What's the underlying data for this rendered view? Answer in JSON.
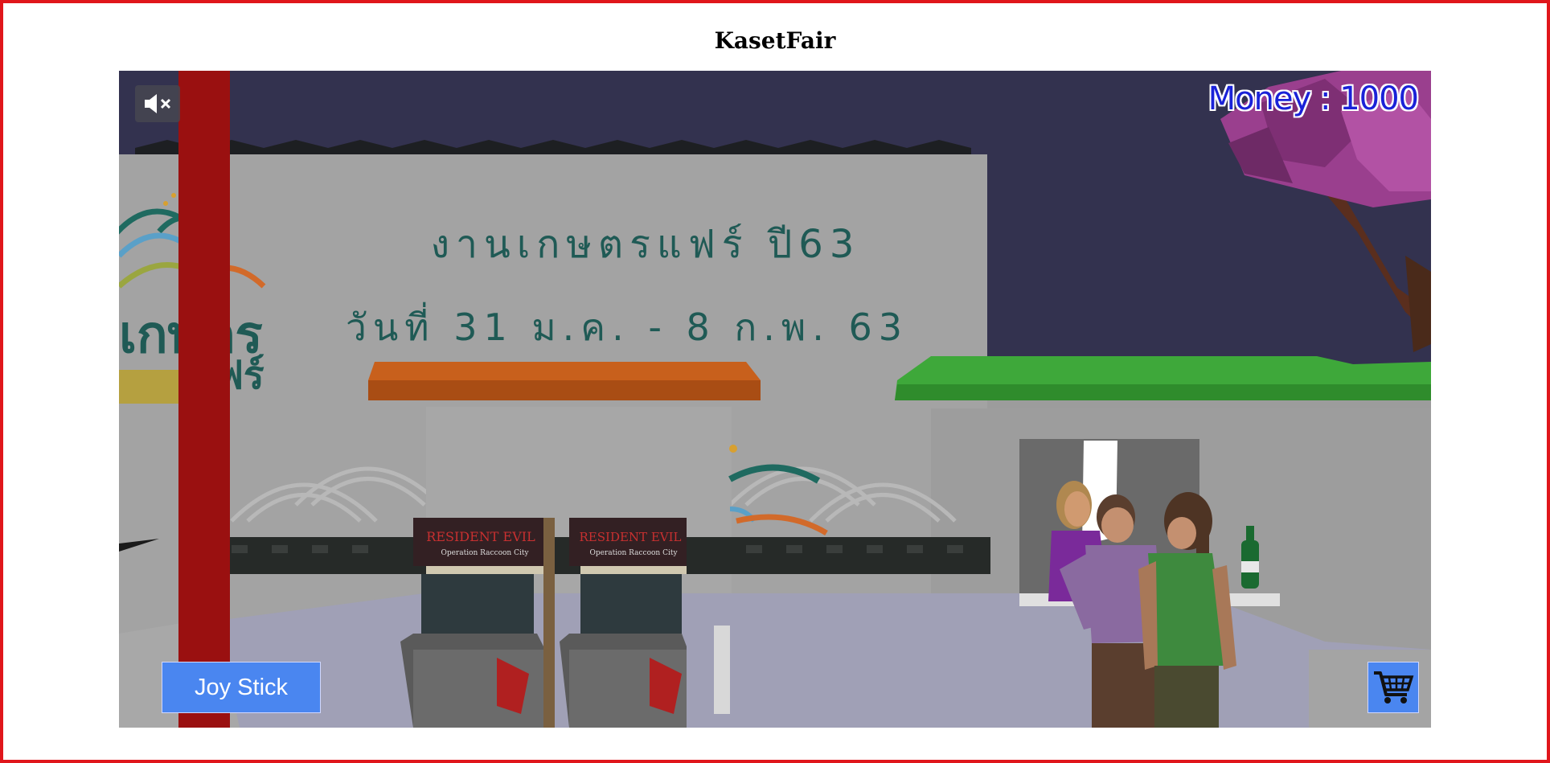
{
  "page": {
    "title": "KasetFair"
  },
  "hud": {
    "money_label": "Money",
    "money_separator": " : ",
    "money_value": "1000",
    "joystick_label": "Joy Stick"
  },
  "icons": {
    "mute": "speaker-muted-icon",
    "cart": "shopping-cart-icon"
  },
  "scene": {
    "banner_line1": "งานเกษตรแฟร์ ปี63",
    "banner_line2": "วันที่ 31 ม.ค. - 8 ก.พ. 63",
    "logo_text_top": "เกษตร",
    "logo_text_bottom": "แฟร์",
    "arcade_brand": "RESIDENT EVIL",
    "arcade_subtitle": "Operation Raccoon City"
  },
  "colors": {
    "border": "#e0161b",
    "sky": "#33324f",
    "wall": "#9e9e9e",
    "money_text": "#1a22d8",
    "button_blue": "#4a86f0",
    "pillar_red": "#9a1010",
    "awning_orange": "#c8601c",
    "awning_green": "#3ea83a",
    "tree_purple": "#9a3f8e"
  }
}
